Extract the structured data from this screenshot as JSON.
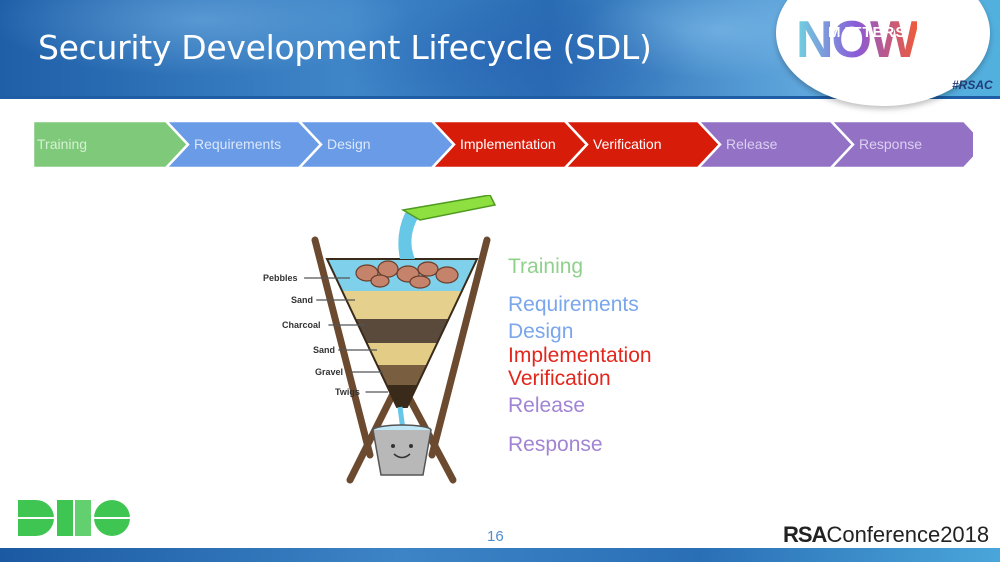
{
  "header": {
    "title": "Security Development Lifecycle (SDL)",
    "badge": {
      "big_word": "NOW",
      "small_word": "MATTERS",
      "hashtag": "#RSAC"
    }
  },
  "process_bar": {
    "stages": [
      {
        "label": "Training",
        "color": "#7fc97a",
        "text_color": "#d6f0d3"
      },
      {
        "label": "Requirements",
        "color": "#6a9be6",
        "text_color": "#dce8fa"
      },
      {
        "label": "Design",
        "color": "#6a9be6",
        "text_color": "#dce8fa"
      },
      {
        "label": "Implementation",
        "color": "#d81c0a",
        "text_color": "#ffffff"
      },
      {
        "label": "Verification",
        "color": "#d81c0a",
        "text_color": "#ffffff"
      },
      {
        "label": "Release",
        "color": "#9372c6",
        "text_color": "#dcd0ef"
      },
      {
        "label": "Response",
        "color": "#9372c6",
        "text_color": "#dcd0ef"
      }
    ]
  },
  "diagram": {
    "layer_labels": [
      "Pebbles",
      "Sand",
      "Charcoal",
      "Sand",
      "Gravel",
      "Twigs"
    ]
  },
  "stage_list": [
    {
      "label": "Training",
      "color": "#8fd18a"
    },
    {
      "label": "Requirements",
      "color": "#7aa6ec"
    },
    {
      "label": "Design",
      "color": "#7aa6ec"
    },
    {
      "label": "Implementation",
      "color": "#e2261c"
    },
    {
      "label": "Verification",
      "color": "#e2261c"
    },
    {
      "label": "Release",
      "color": "#a184d3"
    },
    {
      "label": "Response",
      "color": "#a184d3"
    }
  ],
  "footer": {
    "page_number": "16",
    "logo_strong": "RSA",
    "logo_rest": "Conference2018",
    "duo_logo": "DUO"
  }
}
